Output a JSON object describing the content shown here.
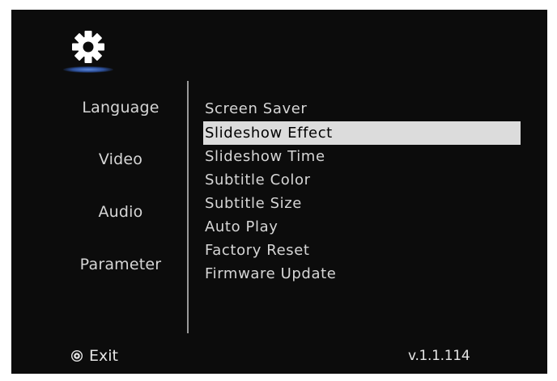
{
  "header": {
    "icon": "gear-icon"
  },
  "left_menu": {
    "items": [
      {
        "label": "Language"
      },
      {
        "label": "Video"
      },
      {
        "label": "Audio"
      },
      {
        "label": "Parameter"
      }
    ]
  },
  "right_menu": {
    "selected_index": 1,
    "items": [
      {
        "label": "Screen Saver"
      },
      {
        "label": "Slideshow Effect"
      },
      {
        "label": "Slideshow Time"
      },
      {
        "label": "Subtitle Color"
      },
      {
        "label": "Subtitle Size"
      },
      {
        "label": "Auto Play"
      },
      {
        "label": "Factory Reset"
      },
      {
        "label": "Firmware Update"
      }
    ]
  },
  "footer": {
    "exit_icon": "exit-button-icon",
    "exit_label": "Exit",
    "version": "v.1.1.114"
  },
  "colors": {
    "background": "#0c0c0c",
    "text": "#d6d6d6",
    "highlight": "#dcdcdc",
    "accent": "#3a67c4"
  }
}
